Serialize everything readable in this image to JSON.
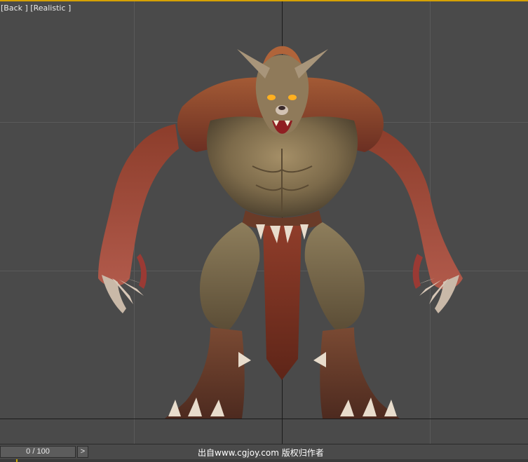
{
  "viewport": {
    "label": "[Back ] [Realistic ]"
  },
  "timeline": {
    "frame_readout": "0 / 100",
    "next_label": ">"
  },
  "watermark": "出自www.cgjoy.com 版权归作者",
  "colors": {
    "viewport_bg": "#4a4a4a",
    "active_border": "#d6a100",
    "grid": "#5a5a5a",
    "axis": "#1b1b1b"
  }
}
